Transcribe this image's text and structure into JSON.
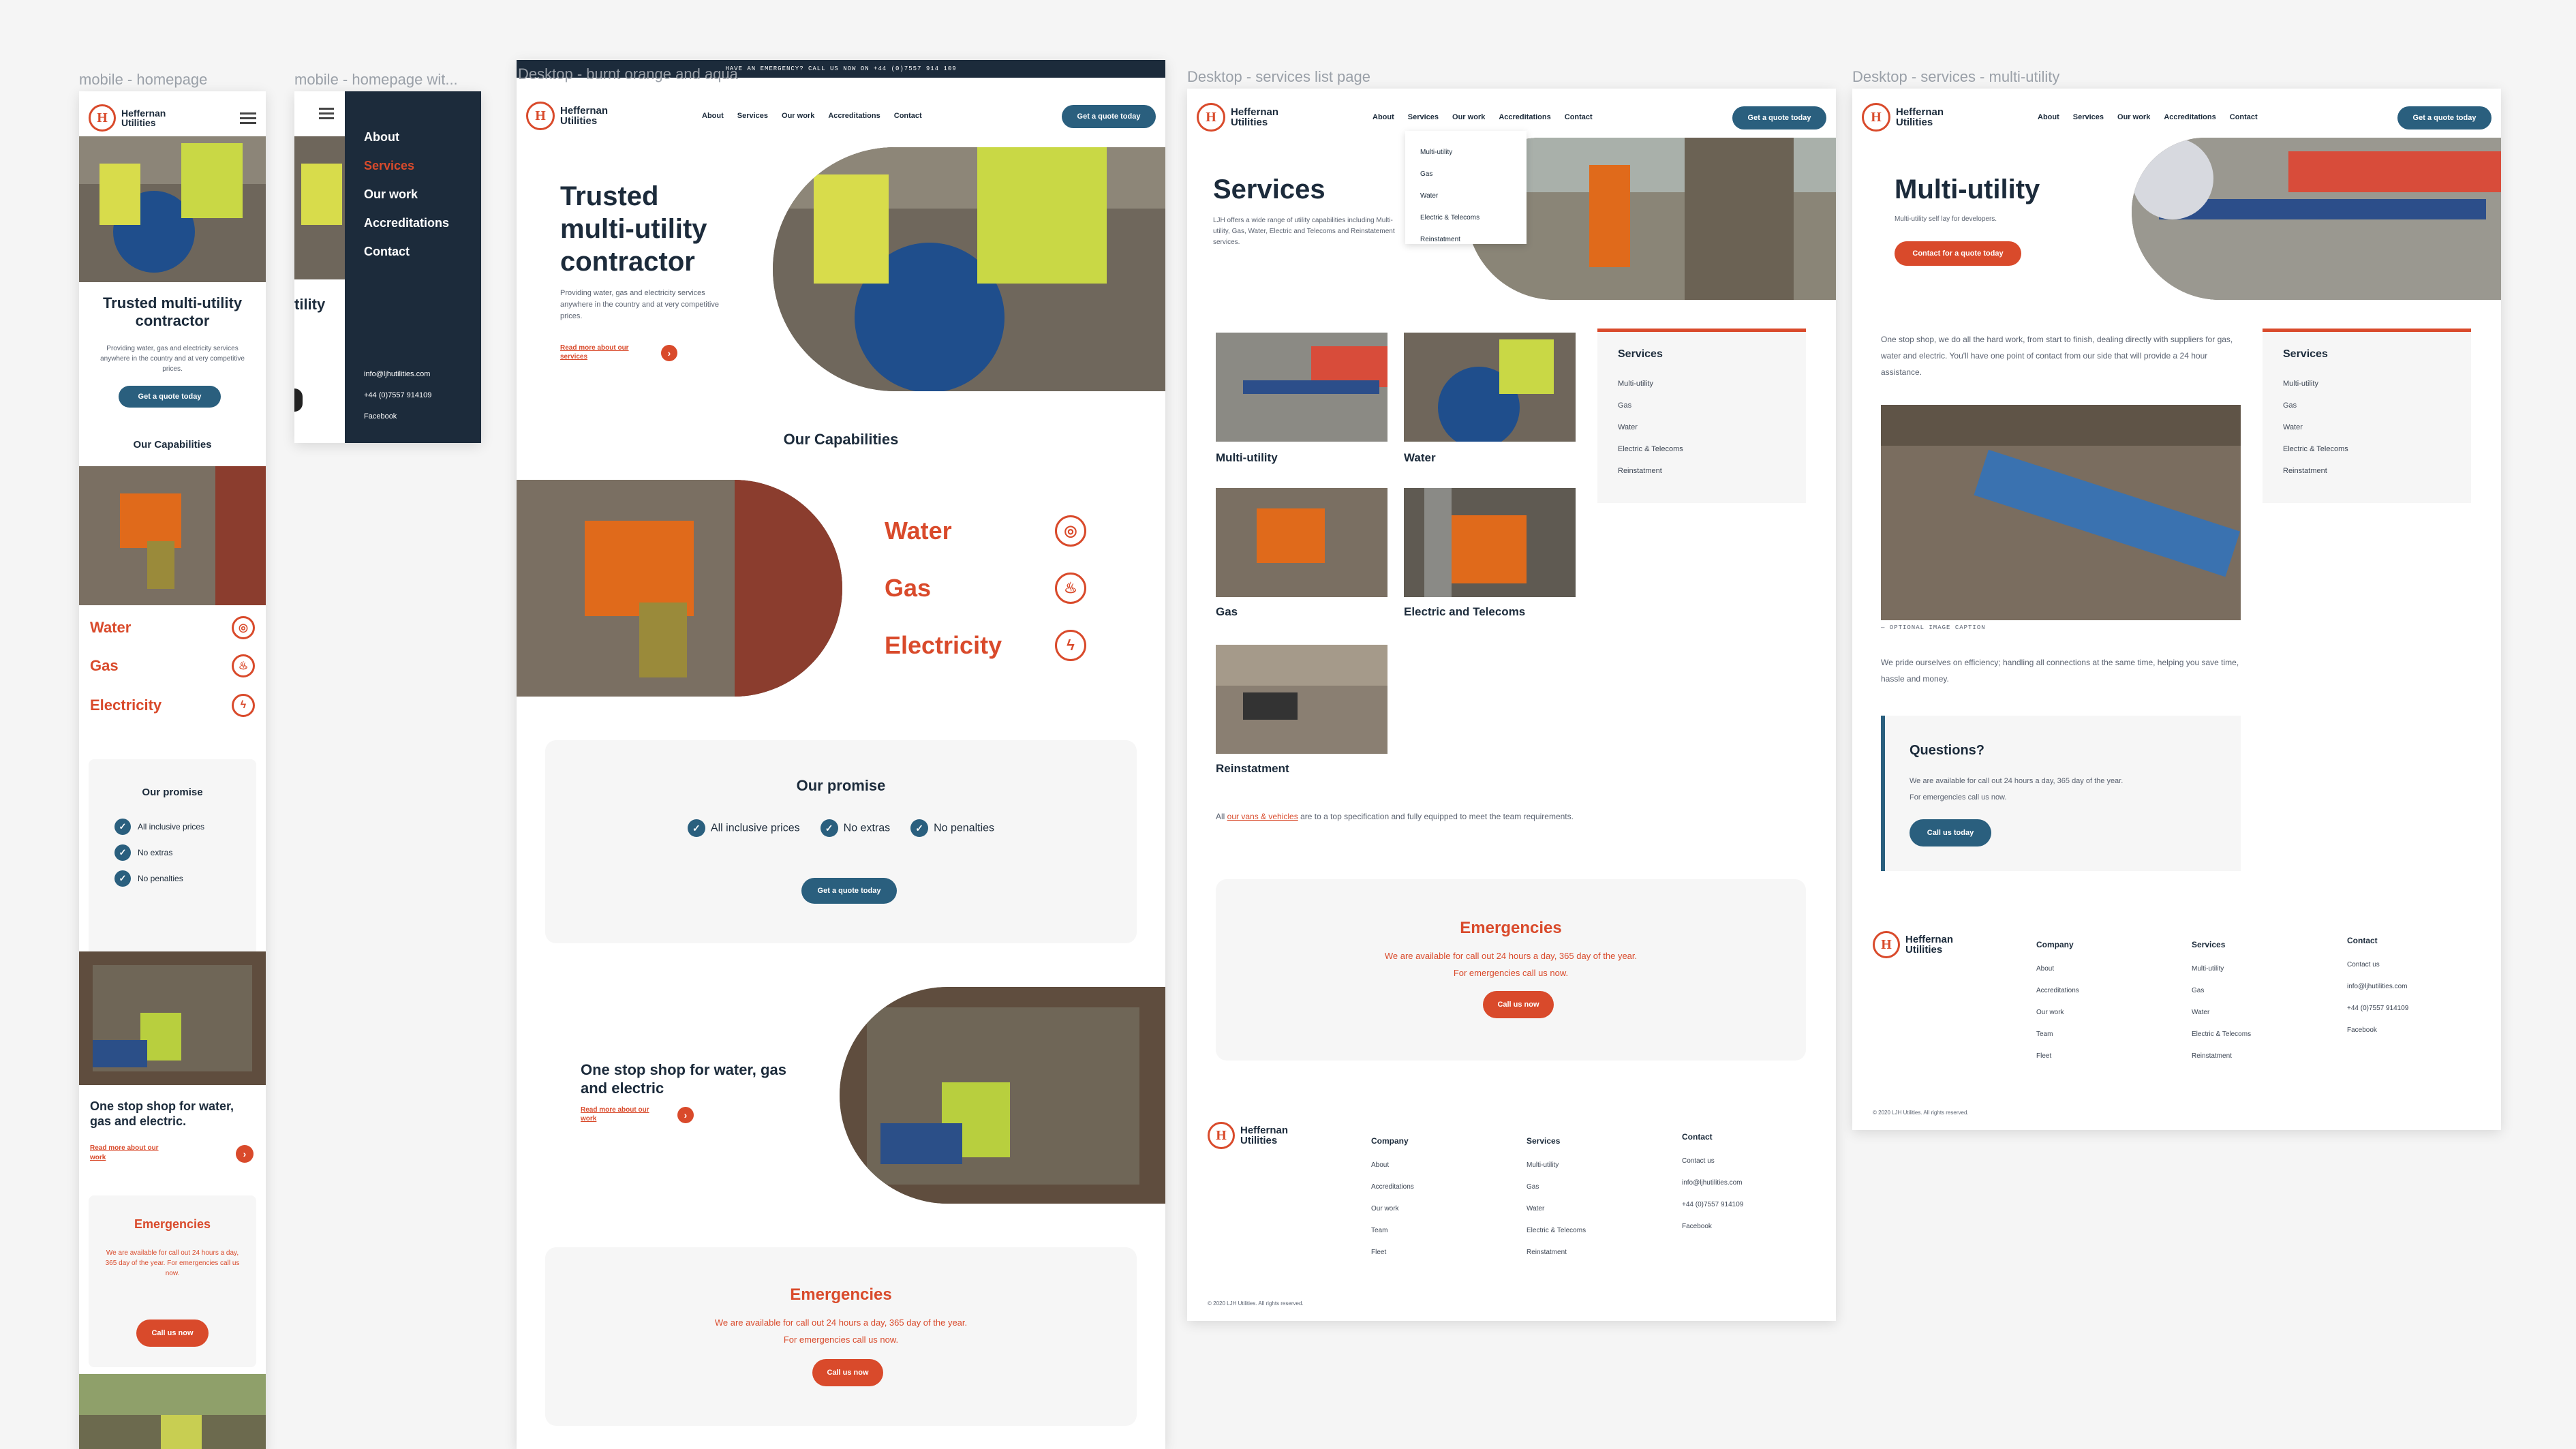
{
  "labels": {
    "mobile_home": "mobile - homepage",
    "mobile_menu": "mobile - homepage wit...",
    "desktop_home": "Desktop - burnt orange and aqua",
    "services_list": "Desktop - services list page",
    "services_multi": "Desktop - services - multi-utility"
  },
  "brand": {
    "name1": "Heffernan",
    "name2": "Utilities",
    "mark": "H",
    "accent": "#d94a2b",
    "navy": "#1c2b3b",
    "teal": "#2a5f7e"
  },
  "nav": [
    "About",
    "Services",
    "Our work",
    "Accreditations",
    "Contact"
  ],
  "quote_btn": "Get a quote today",
  "topbar": "HAVE AN EMERGENCY? CALL US NOW ON +44 (0)7557 914 109",
  "hero": {
    "title_m": "Trusted multi-utility contractor",
    "title_1": "Trusted",
    "title_2": "multi-utility",
    "title_3": "contractor",
    "sub": "Providing water, gas and electricity services anywhere in the country and at very competitive prices.",
    "link": "Read more about our services"
  },
  "capabilities": {
    "title": "Our Capabilities",
    "items": [
      "Water",
      "Gas",
      "Electricity"
    ]
  },
  "promise": {
    "title": "Our promise",
    "items": [
      "All inclusive prices",
      "No extras",
      "No penalties"
    ],
    "btn": "Get a quote today"
  },
  "onestop": {
    "title_m": "One stop shop for water, gas and electric.",
    "title": "One stop shop for water, gas and electric",
    "link": "Read more about our work"
  },
  "emergency": {
    "title": "Emergencies",
    "line1": "We are available for call out 24 hours a day, 365 day of the year.",
    "line2": "For emergencies call us now.",
    "btn": "Call us now"
  },
  "mobile_menu": {
    "items": [
      "About",
      "Services",
      "Our work",
      "Accreditations",
      "Contact"
    ],
    "email": "info@ljhutilities.com",
    "phone": "+44 (0)7557 914109",
    "social": "Facebook"
  },
  "services_page": {
    "title": "Services",
    "intro": "LJH offers a wide range of utility capabilities including Multi-utility, Gas, Water, Electric and Telecoms and Reinstatement services.",
    "dropdown": [
      "Multi-utility",
      "Gas",
      "Water",
      "Electric & Telecoms",
      "Reinstatment"
    ],
    "tiles": [
      "Multi-utility",
      "Water",
      "Gas",
      "Electric and Telecoms",
      "Reinstatment"
    ],
    "note_pre": "All ",
    "note_link": "our vans & vehicles",
    "note_post": " are to a top specification and fully equipped to meet the team requirements."
  },
  "sidebar": {
    "title": "Services",
    "items": [
      "Multi-utility",
      "Gas",
      "Water",
      "Electric & Telecoms",
      "Reinstatment"
    ]
  },
  "multi_page": {
    "title": "Multi-utility",
    "sub": "Multi-utility self lay for developers.",
    "btn": "Contact for a quote today",
    "body1": "One stop shop, we do all the hard work, from start to finish, dealing directly with suppliers for gas, water and electric. You'll have one point of contact from our side that will provide a 24 hour assistance.",
    "caption": "— OPTIONAL IMAGE CAPTION",
    "body2": "We pride ourselves on efficiency; handling all connections at the same time, helping you save time, hassle and money.",
    "q_title": "Questions?",
    "q_text1": "We are available for call out 24 hours a day, 365 day of the year.",
    "q_text2": "For emergencies call us now.",
    "q_btn": "Call us today"
  },
  "footer": {
    "company_h": "Company",
    "company": [
      "About",
      "Accreditations",
      "Our work",
      "Team",
      "Fleet"
    ],
    "services_h": "Services",
    "services": [
      "Multi-utility",
      "Gas",
      "Water",
      "Electric & Telecoms",
      "Reinstatment"
    ],
    "contact_h": "Contact",
    "contact": [
      "Contact us",
      "info@ljhutilities.com",
      "+44 (0)7557 914109",
      "Facebook"
    ],
    "copy": "© 2020 LJH Utilities. All rights reserved."
  }
}
